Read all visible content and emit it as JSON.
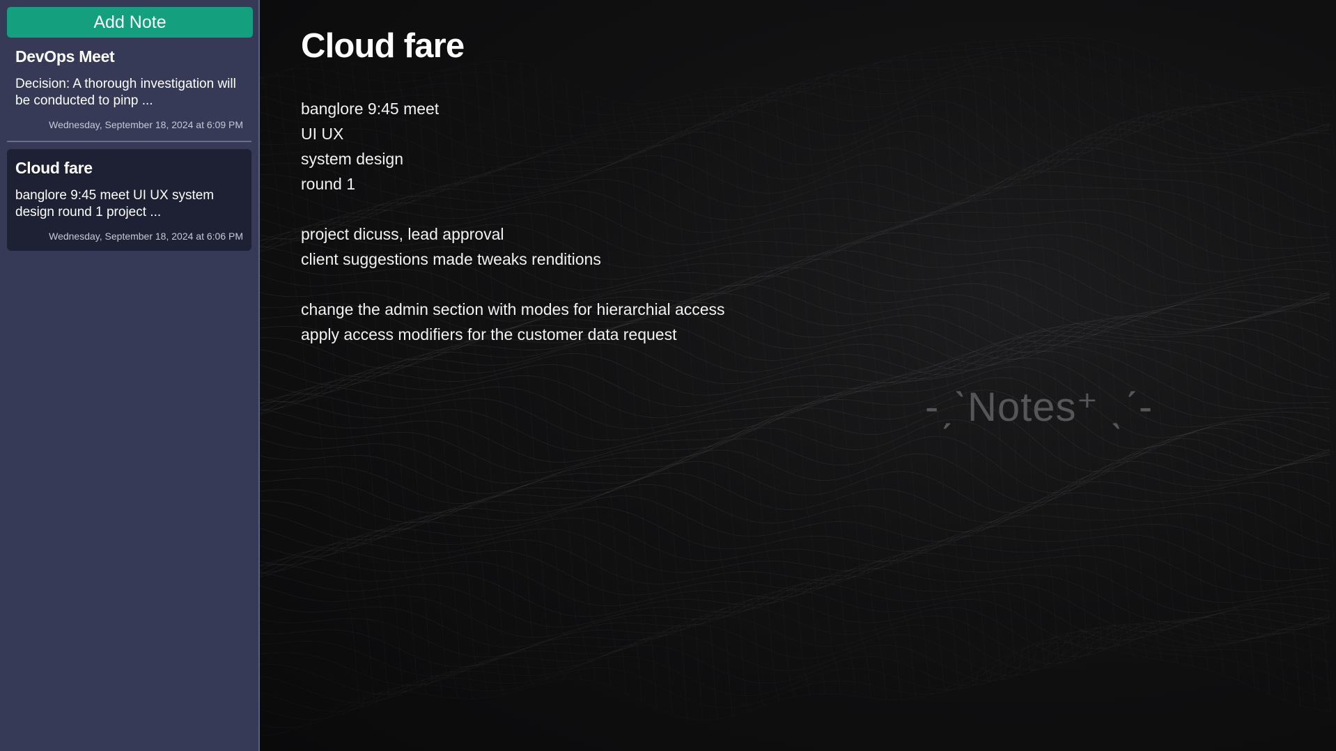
{
  "sidebar": {
    "add_note_label": "Add Note",
    "notes": [
      {
        "title": "DevOps Meet",
        "preview": "Decision: A thorough investigation will be conducted to pinp ...",
        "date": "Wednesday, September 18, 2024 at 6:09 PM"
      },
      {
        "title": "Cloud fare",
        "preview": "banglore 9:45 meet UI UX system design round 1 project ...",
        "date": "Wednesday, September 18, 2024 at 6:06 PM",
        "selected": true
      }
    ]
  },
  "editor": {
    "title": "Cloud fare",
    "lines": [
      "banglore 9:45 meet",
      "UI UX",
      "system design",
      "round 1",
      "",
      "project dicuss, lead approval",
      "client suggestions made tweaks renditions",
      "",
      "change the admin section with modes for hierarchial access",
      "apply access modifiers for the customer data request"
    ]
  },
  "watermark": "-ˏˋNotes⁺ ˎˊ-",
  "colors": {
    "sidebar_bg": "#363a56",
    "accent": "#14a07f",
    "active_card_bg": "#1e2134",
    "main_bg": "#111112"
  }
}
